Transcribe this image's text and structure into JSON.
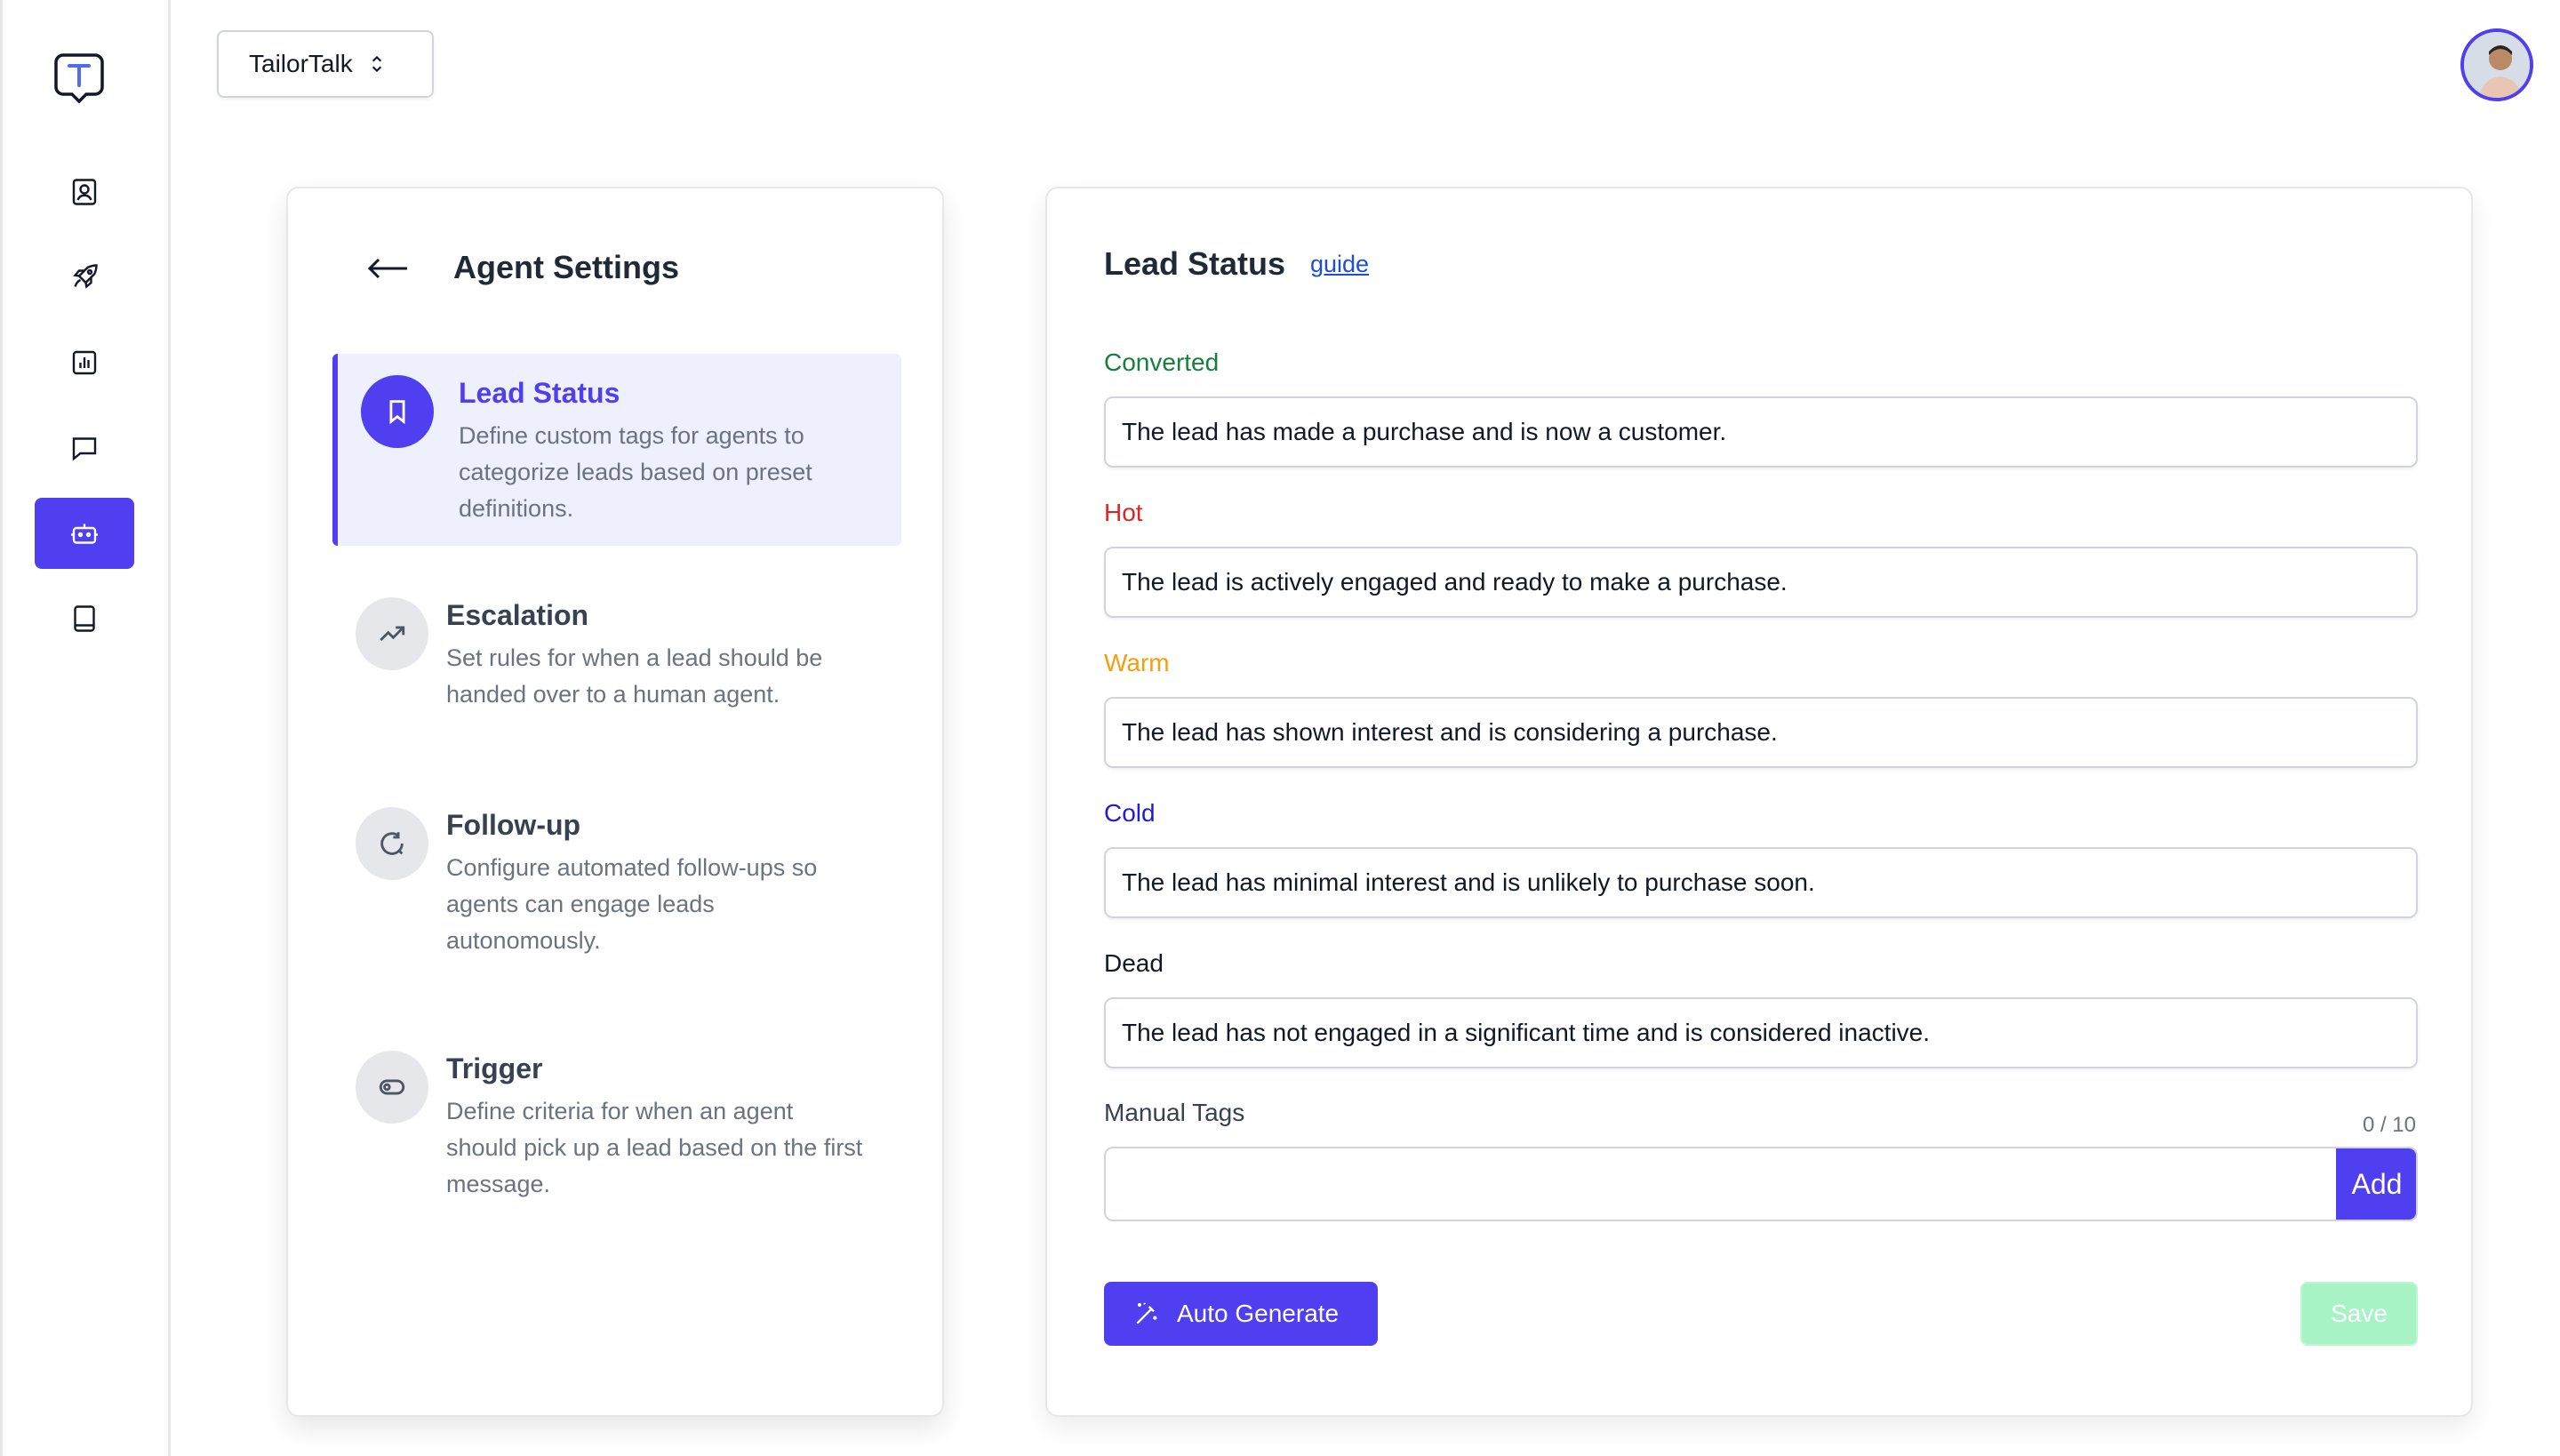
{
  "workspace": {
    "name": "TailorTalk"
  },
  "sidebar": {
    "items": [
      {
        "name": "contacts-icon"
      },
      {
        "name": "rocket-icon"
      },
      {
        "name": "analytics-icon"
      },
      {
        "name": "chat-icon"
      },
      {
        "name": "bot-icon",
        "active": true
      },
      {
        "name": "book-icon"
      }
    ]
  },
  "settings": {
    "title": "Agent Settings",
    "items": [
      {
        "title": "Lead Status",
        "desc": "Define custom tags for agents to categorize leads based on preset definitions.",
        "icon": "bookmark-icon",
        "active": true
      },
      {
        "title": "Escalation",
        "desc": "Set rules for when a lead should be handed over to a human agent.",
        "icon": "trending-up-icon"
      },
      {
        "title": "Follow-up",
        "desc": "Configure automated follow-ups so agents can engage leads autonomously.",
        "icon": "refresh-icon"
      },
      {
        "title": "Trigger",
        "desc": "Define criteria for when an agent should pick up a lead based on the first message.",
        "icon": "toggle-icon"
      }
    ]
  },
  "lead_status": {
    "title": "Lead Status",
    "guide": "guide",
    "statuses": [
      {
        "label": "Converted",
        "color": "#15803d",
        "value": "The lead has made a purchase and is now a customer."
      },
      {
        "label": "Hot",
        "color": "#dc2626",
        "value": "The lead is actively engaged and ready to make a purchase."
      },
      {
        "label": "Warm",
        "color": "#f59e0b",
        "value": "The lead has shown interest and is considering a purchase."
      },
      {
        "label": "Cold",
        "color": "#1d1dd8",
        "value": "The lead has minimal interest and is unlikely to purchase soon."
      },
      {
        "label": "Dead",
        "color": "#111827",
        "value": "The lead has not engaged in a significant time and is considered inactive."
      }
    ],
    "manual_tags_label": "Manual Tags",
    "counter": "0 / 10",
    "tag_input_value": "",
    "add_label": "Add",
    "auto_generate_label": "Auto Generate",
    "save_label": "Save"
  },
  "colors": {
    "accent": "#4f3ff0",
    "save_disabled": "#a7f3c6"
  }
}
